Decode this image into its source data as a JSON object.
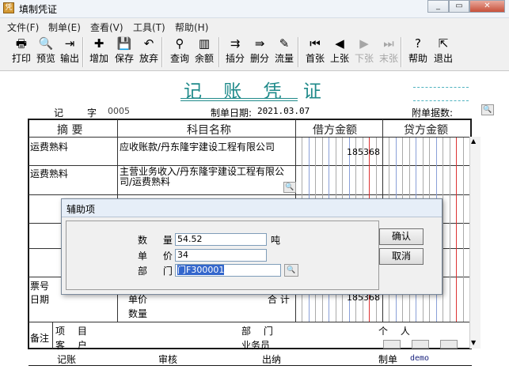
{
  "window": {
    "title": "填制凭证",
    "minimize_label": "▭",
    "maximize_label": "▭",
    "close_label": "✕"
  },
  "menu": [
    "文件(F)",
    "制单(E)",
    "查看(V)",
    "工具(T)",
    "帮助(H)"
  ],
  "toolbar": [
    {
      "label": "打印",
      "icon": "printer-icon",
      "glyph": "🖶"
    },
    {
      "label": "预览",
      "icon": "preview-icon",
      "glyph": "🔍"
    },
    {
      "label": "输出",
      "icon": "export-icon",
      "glyph": "⇥"
    },
    {
      "label": "增加",
      "icon": "add-icon",
      "glyph": "✚"
    },
    {
      "label": "保存",
      "icon": "save-icon",
      "glyph": "💾"
    },
    {
      "label": "放弃",
      "icon": "undo-icon",
      "glyph": "↶"
    },
    {
      "label": "查询",
      "icon": "binoculars-icon",
      "glyph": "⚲"
    },
    {
      "label": "余额",
      "icon": "bar-chart-icon",
      "glyph": "▥"
    },
    {
      "label": "插分",
      "icon": "insert-row-icon",
      "glyph": "⇉"
    },
    {
      "label": "删分",
      "icon": "delete-row-icon",
      "glyph": "⇛"
    },
    {
      "label": "流量",
      "icon": "flow-icon",
      "glyph": "✎"
    },
    {
      "label": "首张",
      "icon": "first-icon",
      "glyph": "⏮"
    },
    {
      "label": "上张",
      "icon": "prev-icon",
      "glyph": "◀"
    },
    {
      "label": "下张",
      "icon": "next-icon",
      "glyph": "▶"
    },
    {
      "label": "末张",
      "icon": "last-icon",
      "glyph": "⏭"
    },
    {
      "label": "帮助",
      "icon": "help-icon",
      "glyph": "?"
    },
    {
      "label": "退出",
      "icon": "exit-icon",
      "glyph": "⇱"
    }
  ],
  "voucher": {
    "title": "记 账 凭 证",
    "type_label": "记",
    "no_label": "字",
    "number": "0005",
    "date_label": "制单日期:",
    "date": "2021.03.07",
    "attachments_label": "附单据数:",
    "col_summary": "摘 要",
    "col_account": "科目名称",
    "col_debit": "借方金额",
    "col_credit": "贷方金额",
    "rows": [
      {
        "summary": "运费熟料",
        "account": "应收账款/丹东隆宇建设工程有限公司",
        "debit": "185368",
        "credit": ""
      },
      {
        "summary": "运费熟料",
        "account": "主营业务收入/丹东隆宇建设工程有限公司/运费熟料",
        "debit": "",
        "credit": ""
      }
    ],
    "bill_no_label": "票号",
    "date_row_label": "日期",
    "unit_price_label": "单价",
    "quantity_label": "数量",
    "total_label": "合 计",
    "total_debit": "185368",
    "remark_label": "备注",
    "project_label": "项 目",
    "customer_label": "客 户",
    "department_label": "部 门",
    "salesperson_label": "业务员",
    "person_label": "个 人",
    "bookkeeper_label": "记账",
    "auditor_label": "审核",
    "cashier_label": "出纳",
    "preparer_label": "制单",
    "preparer": "demo"
  },
  "dialog": {
    "title": "辅助项",
    "qty_label": "数 量",
    "qty_value": "54.52",
    "qty_unit": "吨",
    "price_label": "单 价",
    "price_value": "34",
    "dept_label": "部 门",
    "dept_value": "门F300001",
    "ok_label": "确认",
    "cancel_label": "取消"
  }
}
